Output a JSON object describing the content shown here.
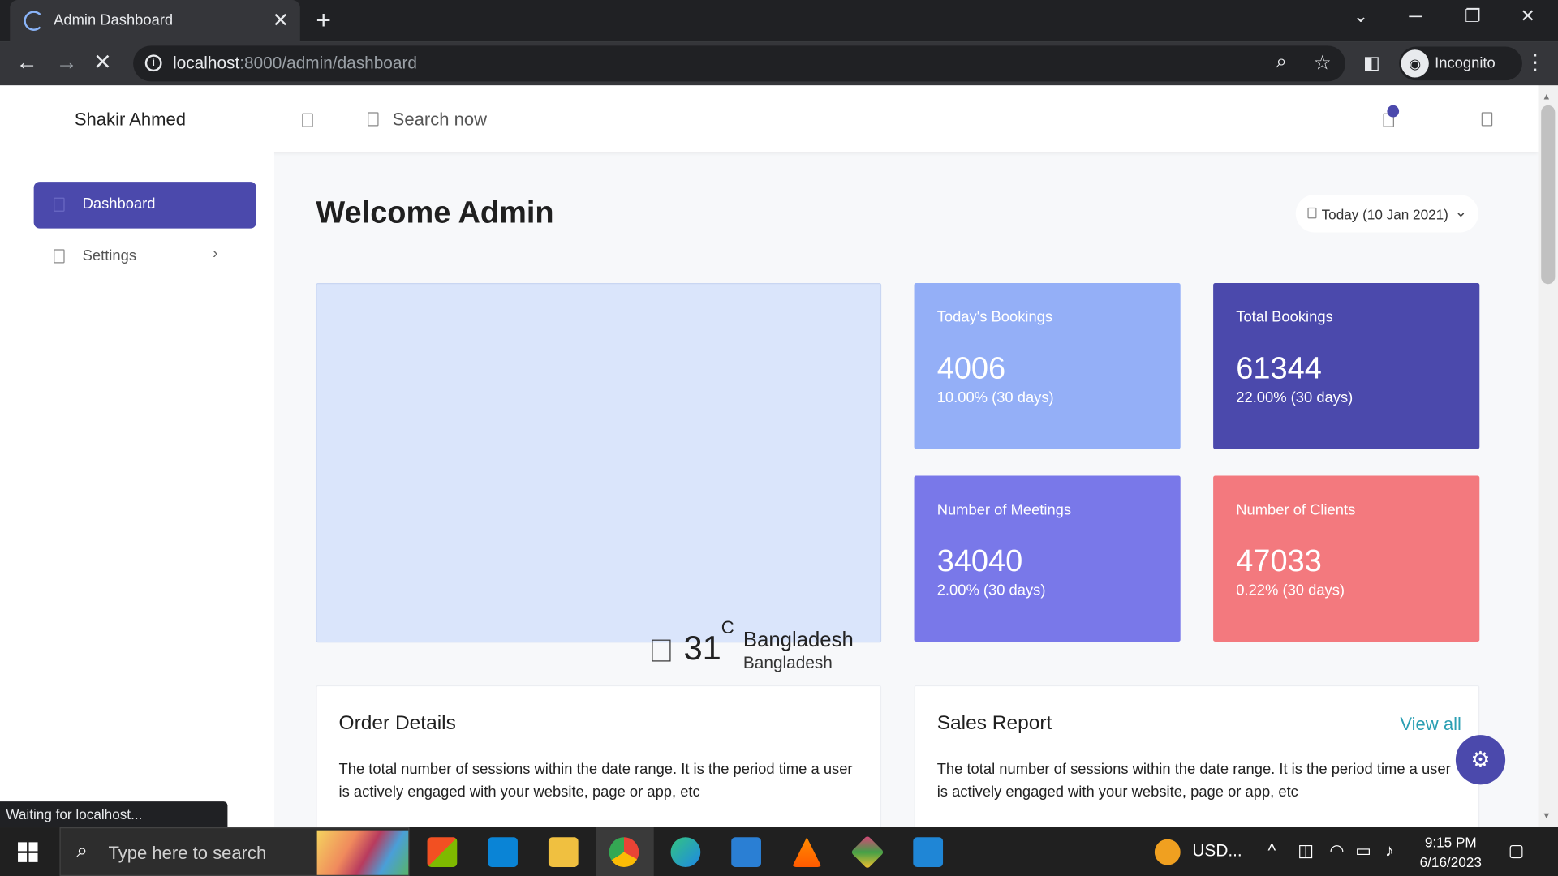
{
  "browser": {
    "tab_title": "Admin Dashboard",
    "url_host": "localhost",
    "url_path": ":8000/admin/dashboard",
    "incognito_label": "Incognito",
    "status_text": "Waiting for localhost..."
  },
  "topnav": {
    "user_name": "Shakir Ahmed",
    "search_placeholder": "Search now"
  },
  "sidebar": {
    "items": [
      {
        "label": "Dashboard",
        "active": true
      },
      {
        "label": "Settings",
        "active": false
      }
    ]
  },
  "main": {
    "welcome": "Welcome Admin",
    "date_filter": "Today (10 Jan 2021)",
    "weather": {
      "temperature": "31",
      "unit": "C",
      "location_primary": "Bangladesh",
      "location_secondary": "Bangladesh"
    },
    "stats": [
      {
        "label": "Today's Bookings",
        "value": "4006",
        "change": "10.00% (30 days)",
        "color": "#94aff7"
      },
      {
        "label": "Total Bookings",
        "value": "61344",
        "change": "22.00% (30 days)",
        "color": "#4b49ac"
      },
      {
        "label": "Number of Meetings",
        "value": "34040",
        "change": "2.00% (30 days)",
        "color": "#7978e9"
      },
      {
        "label": "Number of Clients",
        "value": "47033",
        "change": "0.22% (30 days)",
        "color": "#f3797e"
      }
    ],
    "order_details": {
      "title": "Order Details",
      "text": "The total number of sessions within the date range. It is the period time a user is actively engaged with your website, page or app, etc"
    },
    "sales_report": {
      "title": "Sales Report",
      "link": "View all",
      "text": "The total number of sessions within the date range. It is the period time a user is actively engaged with your website, page or app, etc"
    }
  },
  "taskbar": {
    "search_placeholder": "Type here to search",
    "widget_text": "USD...",
    "time": "9:15 PM",
    "date": "6/16/2023"
  },
  "colors": {
    "accent": "#4b49ac",
    "link": "#2b9fb3"
  }
}
